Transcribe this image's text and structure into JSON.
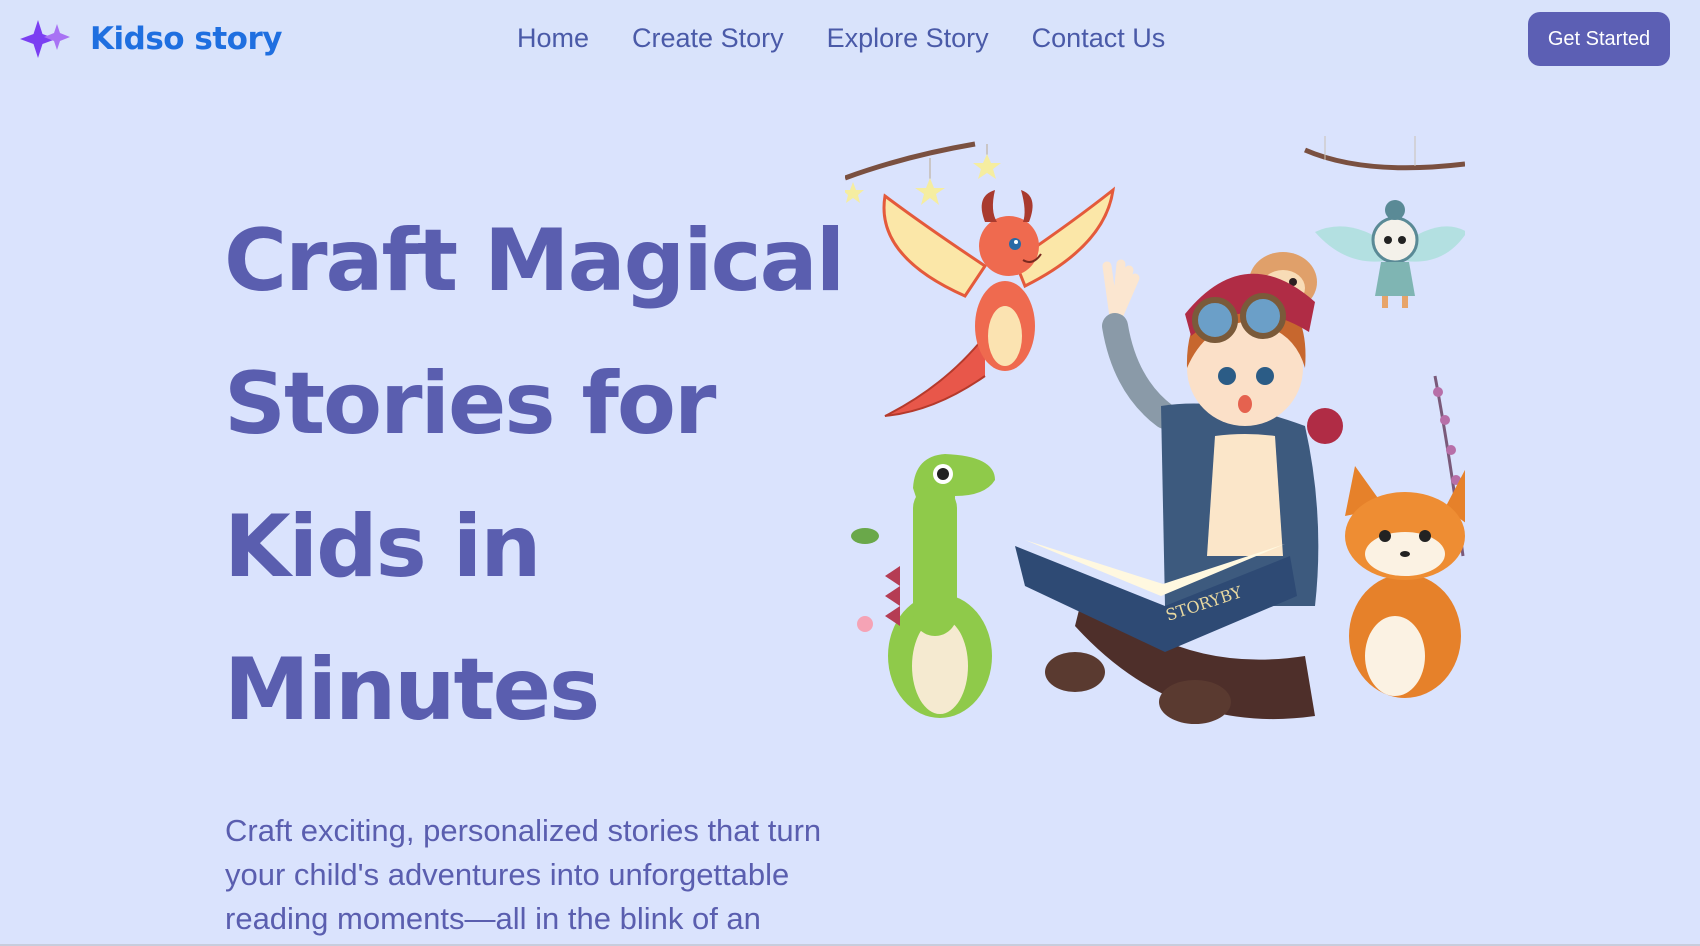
{
  "header": {
    "logo_text": "Kidso story",
    "logo_icon": "sparkle-icon",
    "nav": [
      {
        "label": "Home"
      },
      {
        "label": "Create Story"
      },
      {
        "label": "Explore Story"
      },
      {
        "label": "Contact Us"
      }
    ],
    "cta_label": "Get Started"
  },
  "hero": {
    "heading_lines": [
      "Craft Magical",
      "Stories for",
      "Kids in",
      "Minutes"
    ],
    "subtext": "Craft exciting, personalized stories that turn your child's adventures into unforgettable reading moments—all in the blink of an",
    "book_title": "STORYBY"
  },
  "colors": {
    "background": "#dae3fd",
    "brand_blue": "#1f6fe0",
    "heading": "#5a5eaf",
    "nav_text": "#4a5aa8",
    "button": "#5c5fb4",
    "sparkle_purple": "#7b3ff2"
  }
}
